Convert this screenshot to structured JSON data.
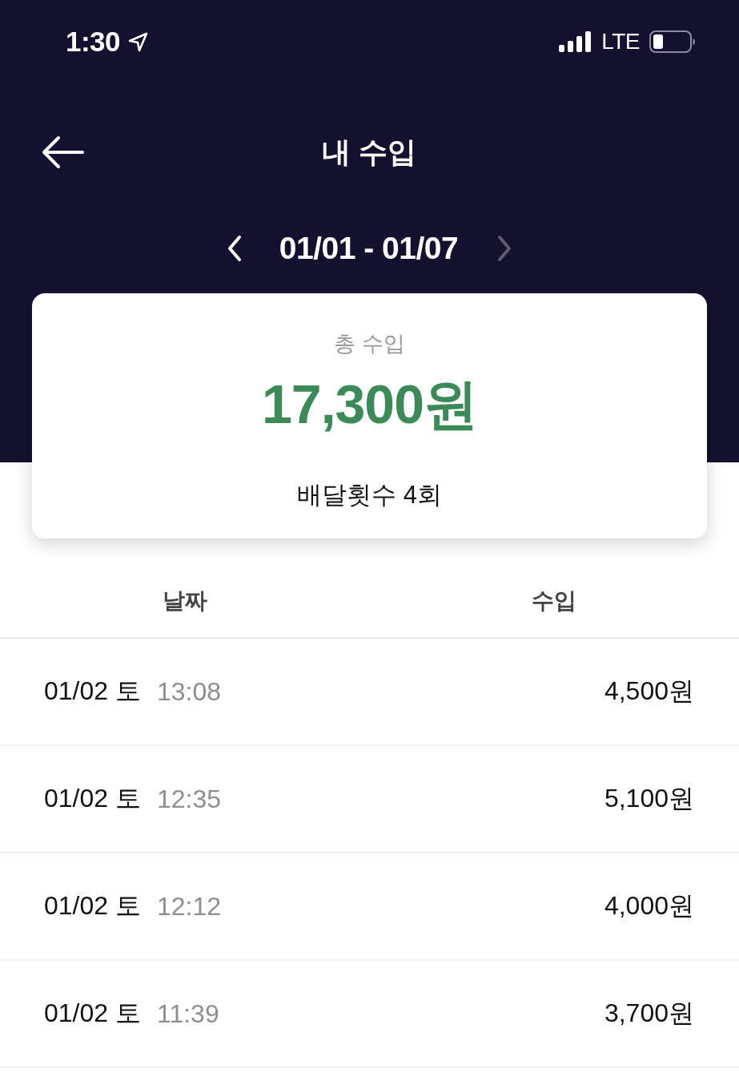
{
  "status_bar": {
    "time": "1:30",
    "network": "LTE"
  },
  "nav": {
    "title": "내 수입"
  },
  "period": {
    "label": "01/01 - 01/07",
    "prev": {
      "disabled": false
    },
    "next": {
      "disabled": true
    }
  },
  "summary": {
    "label": "총 수입",
    "total": "17,300원",
    "deliveries": "배달횟수 4회"
  },
  "table": {
    "columns": [
      "날짜",
      "수입"
    ],
    "rows": [
      {
        "date": "01/02 토",
        "time": "13:08",
        "amount": "4,500원"
      },
      {
        "date": "01/02 토",
        "time": "12:35",
        "amount": "5,100원"
      },
      {
        "date": "01/02 토",
        "time": "12:12",
        "amount": "4,000원"
      },
      {
        "date": "01/02 토",
        "time": "11:39",
        "amount": "3,700원"
      }
    ]
  }
}
